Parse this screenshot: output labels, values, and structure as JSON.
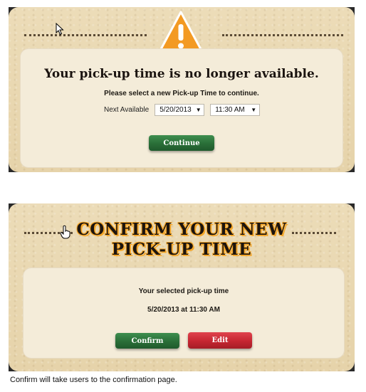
{
  "pickup_unavailable": {
    "title": "Your pick-up time is no longer available.",
    "subtitle": "Please select a new Pick-up Time to continue.",
    "next_available_label": "Next Available",
    "date_select_value": "5/20/2013",
    "time_select_value": "11:30 AM",
    "continue_label": "Continue",
    "warning_icon": "warning-triangle-icon",
    "accent_color": "#f39a23"
  },
  "confirm_pickup": {
    "title_line1": "CONFIRM YOUR NEW",
    "title_line2": "PICK-UP TIME",
    "selected_label": "Your selected pick-up time",
    "selected_value": "5/20/2013 at 11:30 AM",
    "confirm_label": "Confirm",
    "edit_label": "Edit",
    "confirm_color": "#2a6e38",
    "edit_color": "#c52631"
  },
  "caption": "Confirm will take users to the confirmation page."
}
